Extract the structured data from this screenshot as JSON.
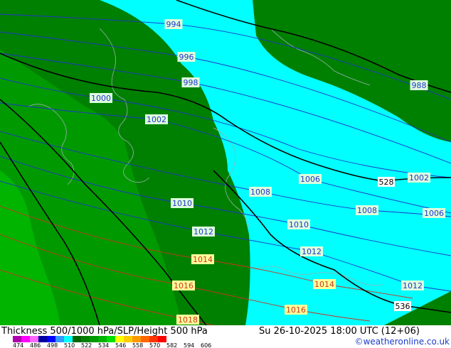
{
  "colors": {
    "cyan_zone": "#00ffff",
    "green_534": "#008000",
    "green_540": "#009a00",
    "green_546": "#00b400",
    "isobar_blue": "#2233cc",
    "isobar_red": "#cc3322",
    "thickness_black": "#000000",
    "coast_grey": "#9ab0b0"
  },
  "isobars": [
    {
      "label": "994",
      "style": "blue"
    },
    {
      "label": "996",
      "style": "blue"
    },
    {
      "label": "998",
      "style": "blue"
    },
    {
      "label": "1000",
      "style": "blue"
    },
    {
      "label": "1002",
      "style": "blue"
    },
    {
      "label": "1006",
      "style": "blue"
    },
    {
      "label": "1008",
      "style": "blue"
    },
    {
      "label": "1008",
      "style": "blue"
    },
    {
      "label": "1010",
      "style": "blue"
    },
    {
      "label": "1010",
      "style": "blue"
    },
    {
      "label": "1012",
      "style": "blue"
    },
    {
      "label": "1012",
      "style": "blue"
    },
    {
      "label": "1012",
      "style": "blue"
    },
    {
      "label": "1014",
      "style": "red"
    },
    {
      "label": "1014",
      "style": "red"
    },
    {
      "label": "1016",
      "style": "red"
    },
    {
      "label": "1016",
      "style": "red"
    },
    {
      "label": "1018",
      "style": "red"
    },
    {
      "label": "988",
      "style": "blue"
    },
    {
      "label": "1002",
      "style": "blue"
    },
    {
      "label": "1006",
      "style": "blue"
    }
  ],
  "thickness_labels": [
    "528",
    "536"
  ],
  "footer": {
    "left_title": "Thickness 500/1000 hPa/SLP/Height 500 hPa",
    "datetime": "Su 26-10-2025 18:00 UTC (12+06)",
    "credit": "©weatheronline.co.uk"
  },
  "legend": {
    "ticks": [
      "474",
      "486",
      "498",
      "510",
      "522",
      "534",
      "546",
      "558",
      "570",
      "582",
      "594",
      "606"
    ],
    "colors": [
      "#b000b0",
      "#ff00ff",
      "#ff66ff",
      "#0000a0",
      "#0000ff",
      "#3399ff",
      "#00ffff",
      "#006400",
      "#008000",
      "#009a00",
      "#00b400",
      "#00e000",
      "#ffff00",
      "#ffcc00",
      "#ff9900",
      "#ff6600",
      "#ff3300",
      "#ff0000"
    ]
  }
}
